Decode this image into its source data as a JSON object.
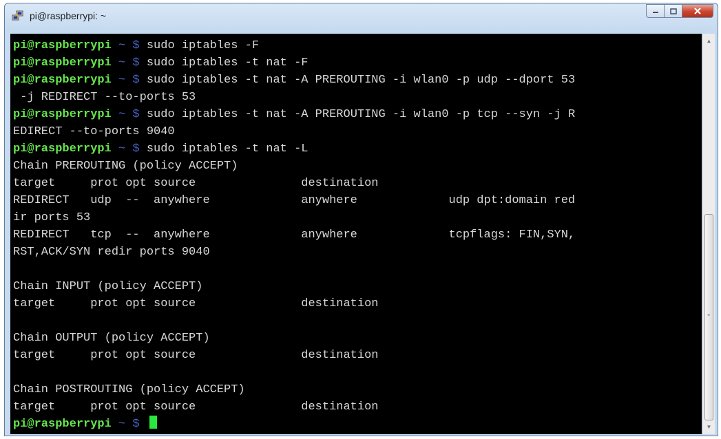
{
  "window": {
    "title": "pi@raspberrypi: ~",
    "icon": "putty-icon",
    "buttons": {
      "minimize": "minimize-icon",
      "maximize": "maximize-icon",
      "close": "close-icon"
    }
  },
  "colors": {
    "prompt_user": "#64e54b",
    "prompt_tilde": "#4b63c9",
    "output": "#d8d8d8",
    "background": "#000000",
    "cursor": "#29e83e"
  },
  "prompt": {
    "user": "pi@raspberrypi",
    "tilde": "~ $"
  },
  "terminal": {
    "lines": [
      {
        "type": "cmd",
        "text": "sudo iptables -F"
      },
      {
        "type": "cmd",
        "text": "sudo iptables -t nat -F"
      },
      {
        "type": "cmd",
        "text": "sudo iptables -t nat -A PREROUTING -i wlan0 -p udp --dport 53"
      },
      {
        "type": "out",
        "text": " -j REDIRECT --to-ports 53"
      },
      {
        "type": "cmd",
        "text": "sudo iptables -t nat -A PREROUTING -i wlan0 -p tcp --syn -j R"
      },
      {
        "type": "out",
        "text": "EDIRECT --to-ports 9040"
      },
      {
        "type": "cmd",
        "text": "sudo iptables -t nat -L"
      },
      {
        "type": "out",
        "text": "Chain PREROUTING (policy ACCEPT)"
      },
      {
        "type": "out",
        "text": "target     prot opt source               destination"
      },
      {
        "type": "out",
        "text": "REDIRECT   udp  --  anywhere             anywhere             udp dpt:domain red"
      },
      {
        "type": "out",
        "text": "ir ports 53"
      },
      {
        "type": "out",
        "text": "REDIRECT   tcp  --  anywhere             anywhere             tcpflags: FIN,SYN,"
      },
      {
        "type": "out",
        "text": "RST,ACK/SYN redir ports 9040"
      },
      {
        "type": "out",
        "text": ""
      },
      {
        "type": "out",
        "text": "Chain INPUT (policy ACCEPT)"
      },
      {
        "type": "out",
        "text": "target     prot opt source               destination"
      },
      {
        "type": "out",
        "text": ""
      },
      {
        "type": "out",
        "text": "Chain OUTPUT (policy ACCEPT)"
      },
      {
        "type": "out",
        "text": "target     prot opt source               destination"
      },
      {
        "type": "out",
        "text": ""
      },
      {
        "type": "out",
        "text": "Chain POSTROUTING (policy ACCEPT)"
      },
      {
        "type": "out",
        "text": "target     prot opt source               destination"
      },
      {
        "type": "prompt",
        "text": ""
      }
    ]
  }
}
